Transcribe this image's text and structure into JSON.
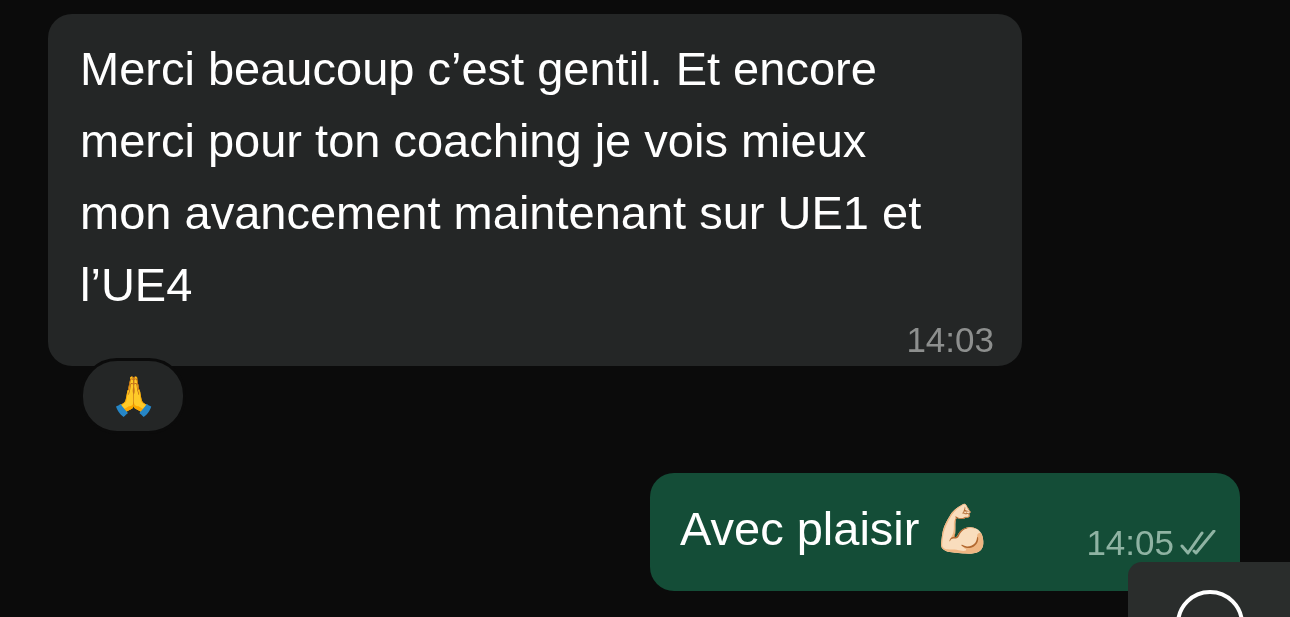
{
  "messages": [
    {
      "kind": "received",
      "text": "Merci beaucoup c’est gentil. Et encore merci pour ton coaching je vois mieux mon avancement maintenant sur UE1 et l’UE4",
      "time": "14:03",
      "reaction": "🙏"
    },
    {
      "kind": "sent",
      "text": "Avec plaisir 💪🏻",
      "time": "14:05",
      "read": false
    }
  ]
}
